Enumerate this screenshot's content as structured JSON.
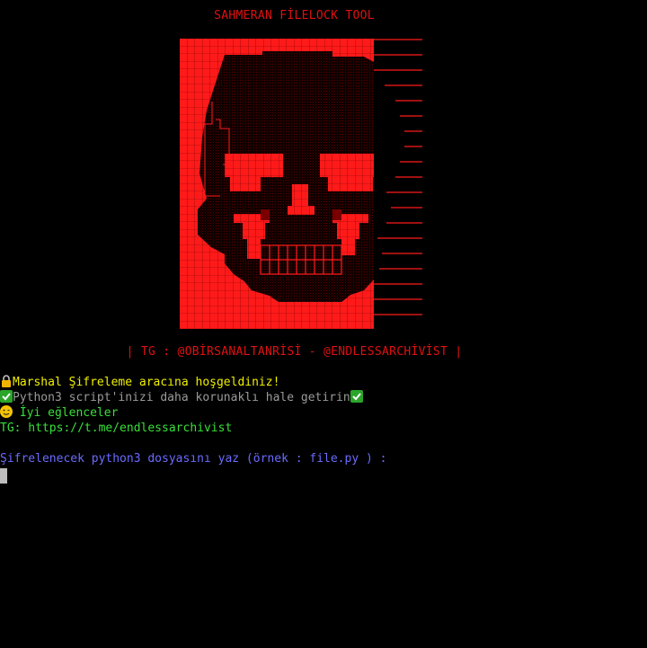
{
  "title": "SAHMERAN FİLELOCK TOOL",
  "tg_line": "| TG : @OBİRSANALTANRİSİ - @ENDLESSARCHİVİST |",
  "messages": {
    "welcome": "Marshal Şifreleme aracına hoşgeldiniz!",
    "protect": "Python3 script'inizi daha korunaklı hale getirin",
    "enjoy": " İyi eğlenceler",
    "tg_link": "TG: https://t.me/endlessarchivist",
    "prompt": "Şifrelenecek python3 dosyasını yaz (örnek : file.py ) :"
  },
  "icons": {
    "welcome": "lock-icon",
    "protect": "check-mark-icon",
    "enjoy": "smiley-icon"
  },
  "colors": {
    "background": "#000000",
    "red": "#e01010",
    "yellow": "#f0f000",
    "gray": "#9a9a9a",
    "green": "#38e038",
    "blue": "#6b6bff"
  }
}
